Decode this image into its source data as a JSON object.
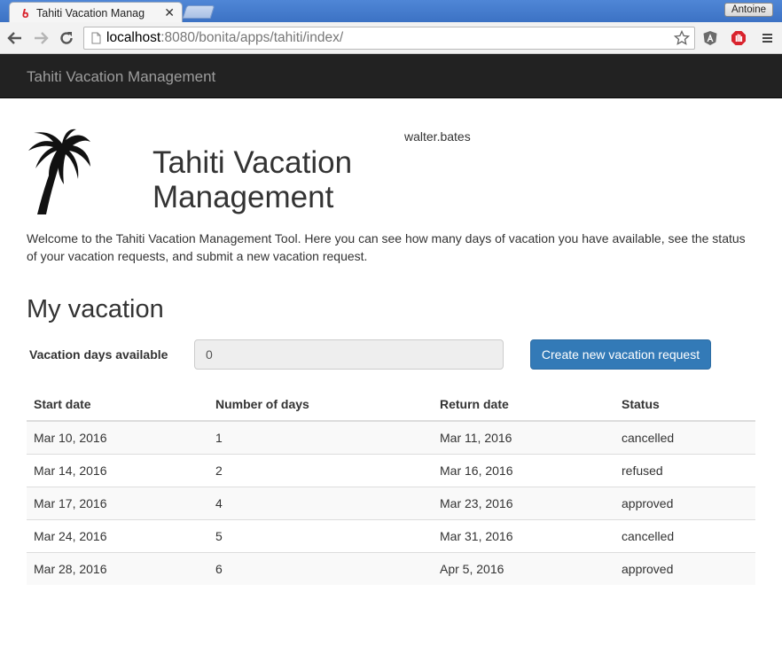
{
  "browser": {
    "tab_title": "Tahiti Vacation Manag",
    "profile_name": "Antoine",
    "url_host": "localhost",
    "url_rest": ":8080/bonita/apps/tahiti/index/"
  },
  "navbar": {
    "brand": "Tahiti Vacation Management"
  },
  "header": {
    "title_line1": "Tahiti Vacation",
    "title_line2": "Management",
    "username": "walter.bates"
  },
  "welcome_text": "Welcome to the Tahiti Vacation Management Tool. Here you can see how many days of vacation you have available, see the status of your vacation requests, and submit a new vacation request.",
  "vacation": {
    "section_title": "My vacation",
    "days_label": "Vacation days available",
    "days_value": "0",
    "create_button": "Create new vacation request"
  },
  "table": {
    "headers": [
      "Start date",
      "Number of days",
      "Return date",
      "Status"
    ],
    "rows": [
      [
        "Mar 10, 2016",
        "1",
        "Mar 11, 2016",
        "cancelled"
      ],
      [
        "Mar 14, 2016",
        "2",
        "Mar 16, 2016",
        "refused"
      ],
      [
        "Mar 17, 2016",
        "4",
        "Mar 23, 2016",
        "approved"
      ],
      [
        "Mar 24, 2016",
        "5",
        "Mar 31, 2016",
        "cancelled"
      ],
      [
        "Mar 28, 2016",
        "6",
        "Apr 5, 2016",
        "approved"
      ]
    ]
  },
  "colors": {
    "navbar_bg": "#222222",
    "primary_button": "#337ab7",
    "chrome_blue": "#4f86d6"
  }
}
